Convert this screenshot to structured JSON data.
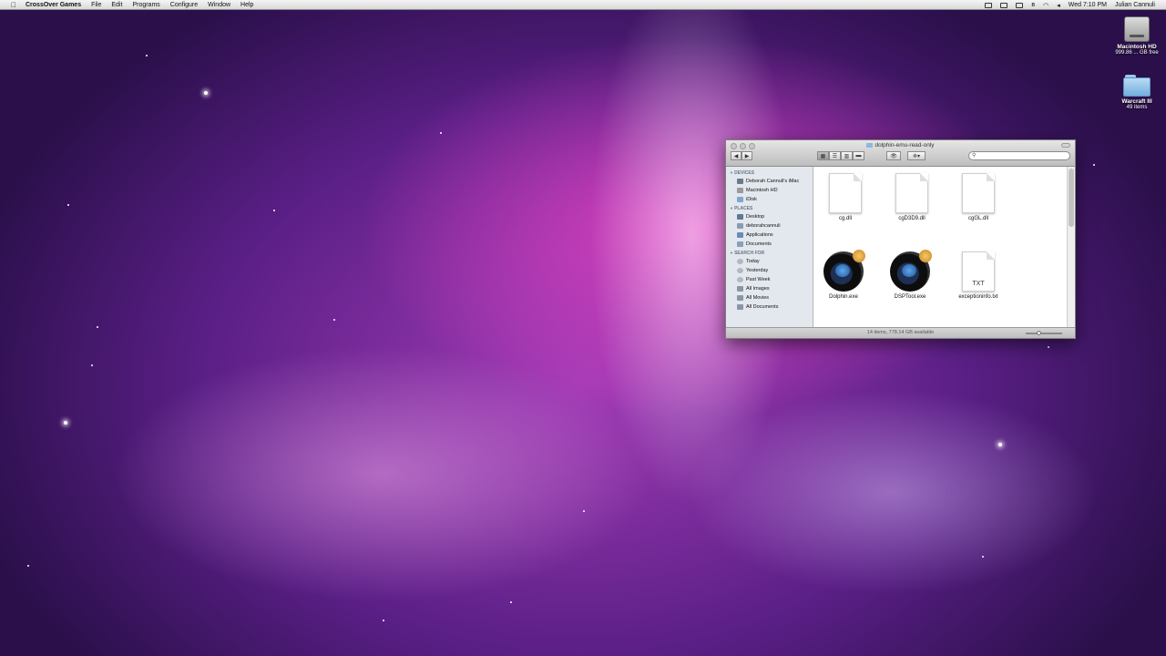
{
  "menubar": {
    "apple": "",
    "app_name": "CrossOver Games",
    "menus": [
      "File",
      "Edit",
      "Programs",
      "Configure",
      "Window",
      "Help"
    ],
    "clock": "Wed 7:10 PM",
    "user": "Julian Cannuli"
  },
  "desktop": {
    "icons": [
      {
        "label": "Macintosh HD",
        "sublabel": "999.86 ... GB free"
      },
      {
        "label": "Warcraft III",
        "sublabel": "49 items"
      }
    ]
  },
  "finder": {
    "title": "dolphin-emu-read-only",
    "back": "◀",
    "forward": "▶",
    "eye": "👁",
    "gear": "✲▾",
    "search_placeholder": "",
    "sidebar": {
      "devices_header": "DEVICES",
      "devices": [
        "Deborah Cannuli's iMac",
        "Macintosh HD",
        "iDisk"
      ],
      "places_header": "PLACES",
      "places": [
        "Desktop",
        "deborahcannuli",
        "Applications",
        "Documents"
      ],
      "search_header": "SEARCH FOR",
      "search_for": [
        "Today",
        "Yesterday",
        "Past Week",
        "All Images",
        "All Movies",
        "All Documents"
      ]
    },
    "files": [
      {
        "name": "cg.dll",
        "kind": "doc"
      },
      {
        "name": "cgD3D9.dll",
        "kind": "doc"
      },
      {
        "name": "cgGL.dll",
        "kind": "doc"
      },
      {
        "name": "Dolphin.exe",
        "kind": "exe"
      },
      {
        "name": "DSPTool.exe",
        "kind": "exe"
      },
      {
        "name": "exceptioninfo.txt",
        "kind": "txt",
        "badge": "TXT"
      }
    ],
    "status": "14 items, 778.14 GB available"
  }
}
